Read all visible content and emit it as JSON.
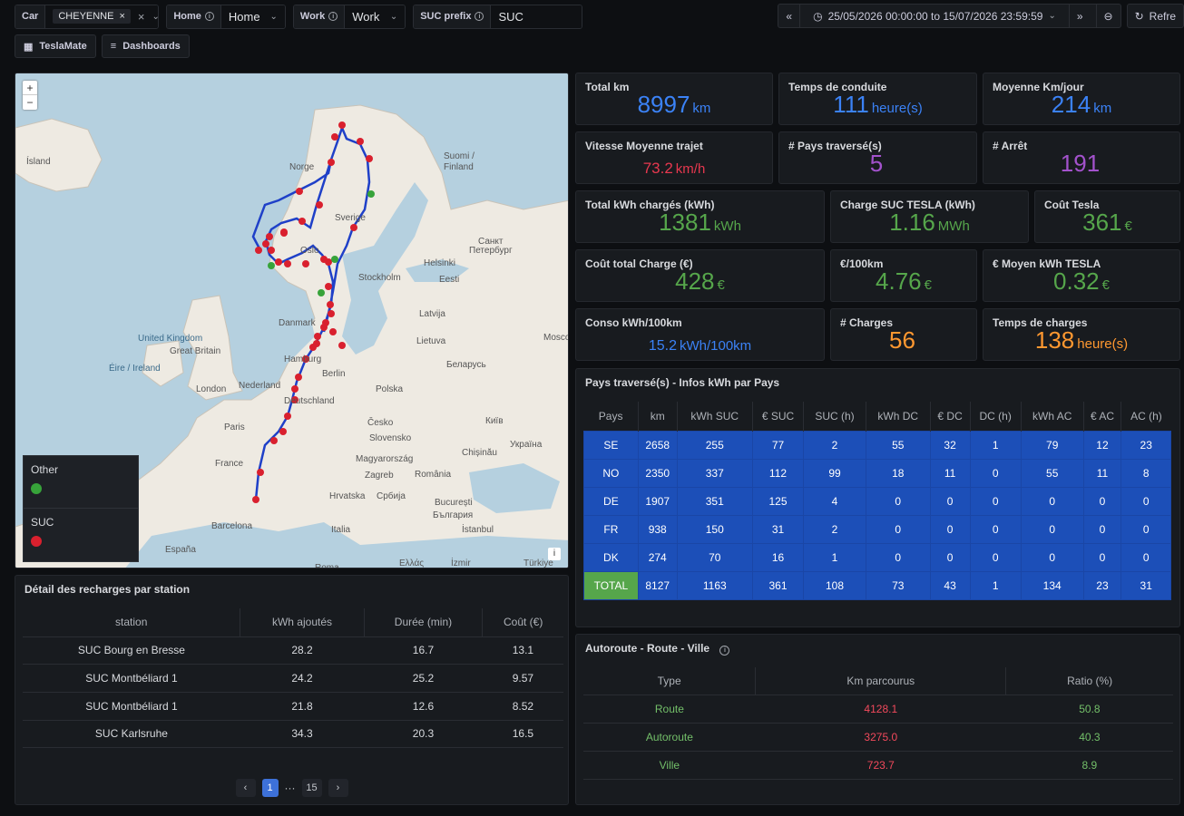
{
  "topbar": {
    "car": {
      "label": "Car",
      "value": "CHEYENNE"
    },
    "home": {
      "label": "Home",
      "value": "Home"
    },
    "work": {
      "label": "Work",
      "value": "Work"
    },
    "suc_prefix": {
      "label": "SUC prefix",
      "value": "SUC"
    },
    "time_range": "25/05/2026 00:00:00 to 15/07/2026 23:59:59",
    "refresh_label": "Refre"
  },
  "nav": {
    "teslamate": "TeslaMate",
    "dashboards": "Dashboards"
  },
  "map": {
    "legend": [
      {
        "label": "Other",
        "color": "#37a33a"
      },
      {
        "label": "SUC",
        "color": "#d9202e"
      }
    ],
    "labels": [
      {
        "text": "Ísland"
      },
      {
        "text": "Norge"
      },
      {
        "text": "Suomi /"
      },
      {
        "text": "Finland"
      },
      {
        "text": "Sverige"
      },
      {
        "text": "Oslo"
      },
      {
        "text": "Санкт"
      },
      {
        "text": "Петербург"
      },
      {
        "text": "Helsinki"
      },
      {
        "text": "Eesti"
      },
      {
        "text": "Stockholm"
      },
      {
        "text": "Latvija"
      },
      {
        "text": "Danmark"
      },
      {
        "text": "Lietuva"
      },
      {
        "text": "United Kingdom"
      },
      {
        "text": "Great Britain"
      },
      {
        "text": "Éire / Ireland"
      },
      {
        "text": "Hamburg"
      },
      {
        "text": "Беларусь"
      },
      {
        "text": "London"
      },
      {
        "text": "Nederland"
      },
      {
        "text": "Berlin"
      },
      {
        "text": "Polska"
      },
      {
        "text": "Deutschland"
      },
      {
        "text": "Київ"
      },
      {
        "text": "Paris"
      },
      {
        "text": "Česko"
      },
      {
        "text": "Slovensko"
      },
      {
        "text": "Україна"
      },
      {
        "text": "France"
      },
      {
        "text": "Magyarország"
      },
      {
        "text": "Chișinău"
      },
      {
        "text": "Zagreb"
      },
      {
        "text": "România"
      },
      {
        "text": "Hrvatska"
      },
      {
        "text": "Србија"
      },
      {
        "text": "București"
      },
      {
        "text": "България"
      },
      {
        "text": "Barcelona"
      },
      {
        "text": "Italia"
      },
      {
        "text": "İstanbul"
      },
      {
        "text": "España"
      },
      {
        "text": "Roma"
      },
      {
        "text": "Ελλάς"
      },
      {
        "text": "İzmir"
      },
      {
        "text": "Türkiye"
      },
      {
        "text": "Mosco"
      }
    ],
    "attribution": "i"
  },
  "stats": {
    "total_km": {
      "title": "Total km",
      "value": "8997",
      "unit": "km"
    },
    "temps_conduite": {
      "title": "Temps de conduite",
      "value": "111",
      "unit": "heure(s)"
    },
    "moyenne_km_jour": {
      "title": "Moyenne Km/jour",
      "value": "214",
      "unit": "km"
    },
    "vitesse_moyenne": {
      "title": "Vitesse Moyenne trajet",
      "value": "73.2",
      "unit": "km/h"
    },
    "pays_traverses": {
      "title": "# Pays traversé(s)",
      "value": "5",
      "unit": ""
    },
    "arret": {
      "title": "# Arrêt",
      "value": "191",
      "unit": ""
    },
    "total_kwh": {
      "title": "Total kWh chargés (kWh)",
      "value": "1381",
      "unit": "kWh"
    },
    "charge_suc": {
      "title": "Charge SUC TESLA (kWh)",
      "value": "1.16",
      "unit": "MWh"
    },
    "cout_tesla": {
      "title": "Coût Tesla",
      "value": "361",
      "unit": "€"
    },
    "cout_total": {
      "title": "Coût total Charge (€)",
      "value": "428",
      "unit": "€"
    },
    "eur_100km": {
      "title": "€/100km",
      "value": "4.76",
      "unit": "€"
    },
    "eur_moyen_kwh": {
      "title": "€ Moyen kWh TESLA",
      "value": "0.32",
      "unit": "€"
    },
    "conso": {
      "title": "Conso kWh/100km",
      "value": "15.2",
      "unit": "kWh/100km"
    },
    "charges": {
      "title": "# Charges",
      "value": "56",
      "unit": ""
    },
    "temps_charges": {
      "title": "Temps de charges",
      "value": "138",
      "unit": "heure(s)"
    }
  },
  "stations": {
    "title": "Détail des recharges par station",
    "columns": [
      "station",
      "kWh ajoutés",
      "Durée (min)",
      "Coût (€)"
    ],
    "rows": [
      [
        "SUC Bourg en Bresse",
        "28.2",
        "16.7",
        "13.1"
      ],
      [
        "SUC Montbéliard 1",
        "24.2",
        "25.2",
        "9.57"
      ],
      [
        "SUC Montbéliard 1",
        "21.8",
        "12.6",
        "8.52"
      ],
      [
        "SUC Karlsruhe",
        "34.3",
        "20.3",
        "16.5"
      ]
    ],
    "pager": {
      "prev": "‹",
      "current": "1",
      "ellipsis": "···",
      "last": "15",
      "next": "›"
    }
  },
  "pays": {
    "title": "Pays traversé(s) - Infos kWh par Pays",
    "columns": [
      "Pays",
      "km",
      "kWh SUC",
      "€ SUC",
      "SUC (h)",
      "kWh DC",
      "€ DC",
      "DC (h)",
      "kWh AC",
      "€ AC",
      "AC (h)"
    ],
    "rows": [
      [
        "SE",
        "2658",
        "255",
        "77",
        "2",
        "55",
        "32",
        "1",
        "79",
        "12",
        "23"
      ],
      [
        "NO",
        "2350",
        "337",
        "112",
        "99",
        "18",
        "11",
        "0",
        "55",
        "11",
        "8"
      ],
      [
        "DE",
        "1907",
        "351",
        "125",
        "4",
        "0",
        "0",
        "0",
        "0",
        "0",
        "0"
      ],
      [
        "FR",
        "938",
        "150",
        "31",
        "2",
        "0",
        "0",
        "0",
        "0",
        "0",
        "0"
      ],
      [
        "DK",
        "274",
        "70",
        "16",
        "1",
        "0",
        "0",
        "0",
        "0",
        "0",
        "0"
      ],
      [
        "TOTAL",
        "8127",
        "1163",
        "361",
        "108",
        "73",
        "43",
        "1",
        "134",
        "23",
        "31"
      ]
    ]
  },
  "routes": {
    "title": "Autoroute - Route - Ville",
    "columns": [
      "Type",
      "Km parcourus",
      "Ratio (%)"
    ],
    "rows": [
      [
        "Route",
        "4128.1",
        "50.8"
      ],
      [
        "Autoroute",
        "3275.0",
        "40.3"
      ],
      [
        "Ville",
        "723.7",
        "8.9"
      ]
    ]
  }
}
